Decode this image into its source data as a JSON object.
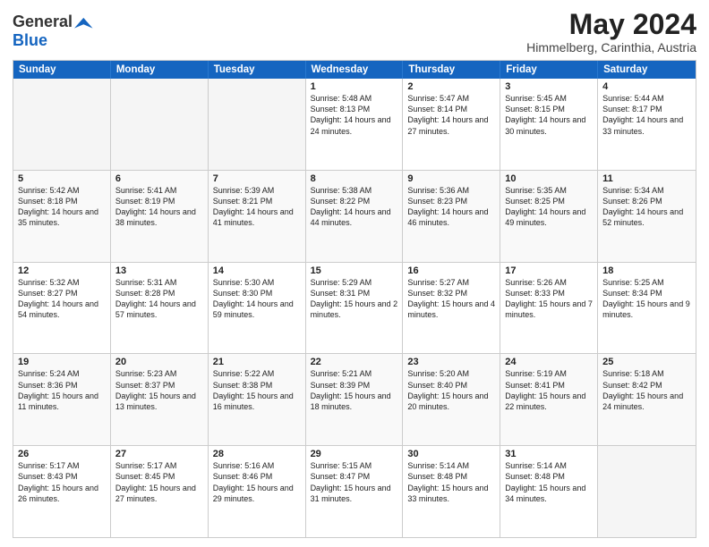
{
  "header": {
    "logo_general": "General",
    "logo_blue": "Blue",
    "month_title": "May 2024",
    "location": "Himmelberg, Carinthia, Austria"
  },
  "days_of_week": [
    "Sunday",
    "Monday",
    "Tuesday",
    "Wednesday",
    "Thursday",
    "Friday",
    "Saturday"
  ],
  "rows": [
    [
      {
        "day": "",
        "empty": true
      },
      {
        "day": "",
        "empty": true
      },
      {
        "day": "",
        "empty": true
      },
      {
        "day": "1",
        "sunrise": "5:48 AM",
        "sunset": "8:13 PM",
        "daylight": "14 hours and 24 minutes."
      },
      {
        "day": "2",
        "sunrise": "5:47 AM",
        "sunset": "8:14 PM",
        "daylight": "14 hours and 27 minutes."
      },
      {
        "day": "3",
        "sunrise": "5:45 AM",
        "sunset": "8:15 PM",
        "daylight": "14 hours and 30 minutes."
      },
      {
        "day": "4",
        "sunrise": "5:44 AM",
        "sunset": "8:17 PM",
        "daylight": "14 hours and 33 minutes."
      }
    ],
    [
      {
        "day": "5",
        "sunrise": "5:42 AM",
        "sunset": "8:18 PM",
        "daylight": "14 hours and 35 minutes."
      },
      {
        "day": "6",
        "sunrise": "5:41 AM",
        "sunset": "8:19 PM",
        "daylight": "14 hours and 38 minutes."
      },
      {
        "day": "7",
        "sunrise": "5:39 AM",
        "sunset": "8:21 PM",
        "daylight": "14 hours and 41 minutes."
      },
      {
        "day": "8",
        "sunrise": "5:38 AM",
        "sunset": "8:22 PM",
        "daylight": "14 hours and 44 minutes."
      },
      {
        "day": "9",
        "sunrise": "5:36 AM",
        "sunset": "8:23 PM",
        "daylight": "14 hours and 46 minutes."
      },
      {
        "day": "10",
        "sunrise": "5:35 AM",
        "sunset": "8:25 PM",
        "daylight": "14 hours and 49 minutes."
      },
      {
        "day": "11",
        "sunrise": "5:34 AM",
        "sunset": "8:26 PM",
        "daylight": "14 hours and 52 minutes."
      }
    ],
    [
      {
        "day": "12",
        "sunrise": "5:32 AM",
        "sunset": "8:27 PM",
        "daylight": "14 hours and 54 minutes."
      },
      {
        "day": "13",
        "sunrise": "5:31 AM",
        "sunset": "8:28 PM",
        "daylight": "14 hours and 57 minutes."
      },
      {
        "day": "14",
        "sunrise": "5:30 AM",
        "sunset": "8:30 PM",
        "daylight": "14 hours and 59 minutes."
      },
      {
        "day": "15",
        "sunrise": "5:29 AM",
        "sunset": "8:31 PM",
        "daylight": "15 hours and 2 minutes."
      },
      {
        "day": "16",
        "sunrise": "5:27 AM",
        "sunset": "8:32 PM",
        "daylight": "15 hours and 4 minutes."
      },
      {
        "day": "17",
        "sunrise": "5:26 AM",
        "sunset": "8:33 PM",
        "daylight": "15 hours and 7 minutes."
      },
      {
        "day": "18",
        "sunrise": "5:25 AM",
        "sunset": "8:34 PM",
        "daylight": "15 hours and 9 minutes."
      }
    ],
    [
      {
        "day": "19",
        "sunrise": "5:24 AM",
        "sunset": "8:36 PM",
        "daylight": "15 hours and 11 minutes."
      },
      {
        "day": "20",
        "sunrise": "5:23 AM",
        "sunset": "8:37 PM",
        "daylight": "15 hours and 13 minutes."
      },
      {
        "day": "21",
        "sunrise": "5:22 AM",
        "sunset": "8:38 PM",
        "daylight": "15 hours and 16 minutes."
      },
      {
        "day": "22",
        "sunrise": "5:21 AM",
        "sunset": "8:39 PM",
        "daylight": "15 hours and 18 minutes."
      },
      {
        "day": "23",
        "sunrise": "5:20 AM",
        "sunset": "8:40 PM",
        "daylight": "15 hours and 20 minutes."
      },
      {
        "day": "24",
        "sunrise": "5:19 AM",
        "sunset": "8:41 PM",
        "daylight": "15 hours and 22 minutes."
      },
      {
        "day": "25",
        "sunrise": "5:18 AM",
        "sunset": "8:42 PM",
        "daylight": "15 hours and 24 minutes."
      }
    ],
    [
      {
        "day": "26",
        "sunrise": "5:17 AM",
        "sunset": "8:43 PM",
        "daylight": "15 hours and 26 minutes."
      },
      {
        "day": "27",
        "sunrise": "5:17 AM",
        "sunset": "8:45 PM",
        "daylight": "15 hours and 27 minutes."
      },
      {
        "day": "28",
        "sunrise": "5:16 AM",
        "sunset": "8:46 PM",
        "daylight": "15 hours and 29 minutes."
      },
      {
        "day": "29",
        "sunrise": "5:15 AM",
        "sunset": "8:47 PM",
        "daylight": "15 hours and 31 minutes."
      },
      {
        "day": "30",
        "sunrise": "5:14 AM",
        "sunset": "8:48 PM",
        "daylight": "15 hours and 33 minutes."
      },
      {
        "day": "31",
        "sunrise": "5:14 AM",
        "sunset": "8:48 PM",
        "daylight": "15 hours and 34 minutes."
      },
      {
        "day": "",
        "empty": true
      }
    ]
  ]
}
